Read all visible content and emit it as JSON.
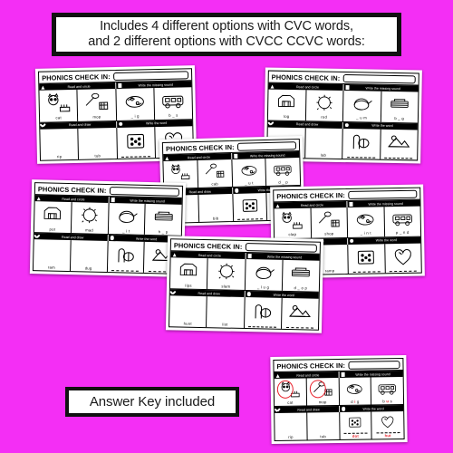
{
  "page": {
    "background_color": "#f42ef5",
    "header": {
      "line1": "Includes 4 different options with CVC words,",
      "line2": "and 2 different options with CVCC CCVC words:"
    },
    "answer_key_banner": "Answer Key included"
  },
  "card_labels": {
    "title": "PHONICS CHECK IN:",
    "read_and_circle": "Read and circle",
    "write_missing_sound": "Write the missing sound",
    "read_and_draw": "Read and draw",
    "write_the_word": "Write the word"
  },
  "cards": [
    {
      "id": "card-cvc-1",
      "read_and_circle": [
        "cat",
        "mop"
      ],
      "write_missing_sound": [
        "_ i g",
        "b _ s"
      ],
      "read_and_draw": [
        "rip",
        "tub"
      ],
      "write_the_word": [
        "",
        ""
      ],
      "is_answer_key": false
    },
    {
      "id": "card-cvc-2",
      "read_and_circle": [
        "log",
        "rod"
      ],
      "write_missing_sound": [
        "_ u m",
        "b _ g"
      ],
      "read_and_draw": [
        "bin",
        "lab"
      ],
      "write_the_word": [
        "",
        ""
      ],
      "is_answer_key": false
    },
    {
      "id": "card-cvc-3",
      "read_and_circle": [
        "top",
        "cab"
      ],
      "write_missing_sound": [
        "_ u t",
        "d _ p"
      ],
      "read_and_draw": [
        "dog",
        "bib"
      ],
      "write_the_word": [
        "",
        ""
      ],
      "is_answer_key": false
    },
    {
      "id": "card-cvc-4",
      "read_and_circle": [
        "pot",
        "mad"
      ],
      "write_missing_sound": [
        "_ i t",
        "h _ p"
      ],
      "read_and_draw": [
        "ram",
        "dug"
      ],
      "write_the_word": [
        "",
        ""
      ],
      "is_answer_key": false
    },
    {
      "id": "card-ccvc-1",
      "read_and_circle": [
        "clap",
        "shop"
      ],
      "write_missing_sound": [
        "_ i n t",
        "p _ n d"
      ],
      "read_and_draw": [
        "pump",
        "ramp"
      ],
      "write_the_word": [
        "",
        ""
      ],
      "is_answer_key": false
    },
    {
      "id": "card-ccvc-2",
      "read_and_circle": [
        "lips",
        "slam"
      ],
      "write_missing_sound": [
        "_ l u g",
        "d _ o p"
      ],
      "read_and_draw": [
        "hunt",
        "list"
      ],
      "write_the_word": [
        "",
        ""
      ],
      "is_answer_key": false
    },
    {
      "id": "card-answer-key",
      "read_and_circle": [
        "cat",
        "mop"
      ],
      "write_missing_sound": [
        "d i g",
        "b u s"
      ],
      "write_missing_sound_answers": [
        "i",
        "u"
      ],
      "read_and_draw": [
        "rip",
        "tub"
      ],
      "write_the_word": [
        "dot",
        "hut"
      ],
      "answer_color": "#e8202a",
      "is_answer_key": true
    }
  ]
}
